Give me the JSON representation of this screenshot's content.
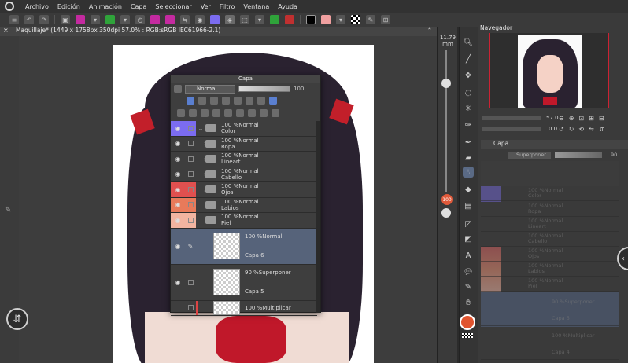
{
  "menu": [
    "Archivo",
    "Edición",
    "Animación",
    "Capa",
    "Seleccionar",
    "Ver",
    "Filtro",
    "Ventana",
    "Ayuda"
  ],
  "doc_tab": {
    "title": "Maquillaje* (1449 x 1758px 350dpi 57.0% : RGB:sRGB IEC61966-2.1)",
    "close": "×"
  },
  "brush_size": {
    "value": "11.79",
    "unit": "mm"
  },
  "size_badge": "100",
  "layer_popup": {
    "title": "Capa",
    "blend_mode": "Normal",
    "opacity": "100",
    "layers": [
      {
        "text1": "100 %Normal",
        "text2": "Color",
        "type": "folder-open",
        "vis_color": "#7b6cf0"
      },
      {
        "text1": "100 %Normal",
        "text2": "Ropa",
        "type": "folder",
        "vis_color": ""
      },
      {
        "text1": "100 %Normal",
        "text2": "Lineart",
        "type": "folder",
        "vis_color": ""
      },
      {
        "text1": "100 %Normal",
        "text2": "Cabello",
        "type": "folder",
        "vis_color": ""
      },
      {
        "text1": "100 %Normal",
        "text2": "Ojos",
        "type": "folder",
        "vis_color": "#e0504f"
      },
      {
        "text1": "100 %Normal",
        "text2": "Labios",
        "type": "folder-open",
        "vis_color": "#e87a5a"
      },
      {
        "text1": "100 %Normal",
        "text2": "Piel",
        "type": "folder-open",
        "vis_color": "#f2b4a0"
      }
    ],
    "sub_layers": [
      {
        "text1": "100 %Normal",
        "text2": "Capa 6",
        "selected": true
      },
      {
        "text1": "90 %Superponer",
        "text2": "Capa 5",
        "selected": false
      },
      {
        "text1": "100 %Multiplicar",
        "text2": "",
        "selected": false
      }
    ]
  },
  "navigator": {
    "title": "Navegador",
    "zoom": "57.0",
    "rotation": "0.0"
  },
  "right_layers": {
    "title": "Capa",
    "blend_mode": "Superponer",
    "opacity": "90",
    "rows": [
      {
        "text1": "100 %Normal",
        "text2": "Color"
      },
      {
        "text1": "100 %Normal",
        "text2": "Ropa"
      },
      {
        "text1": "100 %Normal",
        "text2": "Lineart"
      },
      {
        "text1": "100 %Normal",
        "text2": "Cabello"
      },
      {
        "text1": "100 %Normal",
        "text2": "Ojos"
      },
      {
        "text1": "100 %Normal",
        "text2": "Labios"
      },
      {
        "text1": "100 %Normal",
        "text2": "Piel"
      },
      {
        "text1": "90 %Superponer",
        "text2": "Capa 5"
      },
      {
        "text1": "100 %Multiplicar",
        "text2": "Capa 4"
      }
    ]
  },
  "colors": {
    "accent": "#5a7fd0",
    "main_color": "#e0542f"
  }
}
